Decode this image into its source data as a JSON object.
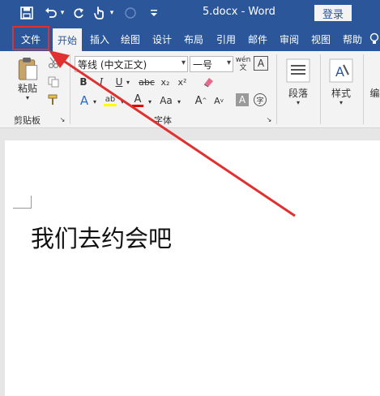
{
  "title_bar": {
    "doc_title": "5.docx  -  Word",
    "login_label": "登录"
  },
  "tabs": [
    {
      "label": "文件"
    },
    {
      "label": "开始"
    },
    {
      "label": "插入"
    },
    {
      "label": "绘图"
    },
    {
      "label": "设计"
    },
    {
      "label": "布局"
    },
    {
      "label": "引用"
    },
    {
      "label": "邮件"
    },
    {
      "label": "审阅"
    },
    {
      "label": "视图"
    },
    {
      "label": "帮助"
    }
  ],
  "ribbon": {
    "clipboard": {
      "paste_label": "粘贴",
      "group_label": "剪贴板"
    },
    "font": {
      "font_name": "等线 (中文正文)",
      "font_size": "一号",
      "phonetic_label": "wén",
      "bold": "B",
      "italic": "I",
      "underline": "U",
      "strike": "abc",
      "subscript": "x₂",
      "superscript": "x²",
      "text_effect": "A",
      "highlight": "ab",
      "font_color": "A",
      "change_case": "Aa",
      "grow": "A",
      "shrink": "A",
      "char_shade": "A",
      "enclose": "字",
      "group_label": "字体"
    },
    "paragraph": {
      "label": "段落"
    },
    "styles": {
      "label": "样式"
    },
    "partial_label": "编"
  },
  "document": {
    "text": "我们去约会吧"
  },
  "colors": {
    "accent": "#2b579a",
    "annotation": "#e03030"
  }
}
